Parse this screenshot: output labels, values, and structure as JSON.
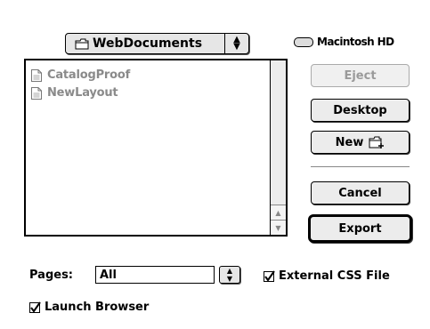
{
  "folder_popup": {
    "label": "WebDocuments",
    "icon": "folder-icon"
  },
  "volume": {
    "label": "Macintosh HD",
    "icon": "hard-drive-icon"
  },
  "file_list": {
    "items": [
      {
        "name": "CatalogProof",
        "icon": "document-icon"
      },
      {
        "name": "NewLayout",
        "icon": "document-icon"
      }
    ]
  },
  "buttons": {
    "eject": "Eject",
    "desktop": "Desktop",
    "new": "New",
    "cancel": "Cancel",
    "export": "Export"
  },
  "pages": {
    "label": "Pages:",
    "value": "All"
  },
  "options": {
    "external_css": {
      "label": "External CSS File",
      "checked": true
    },
    "launch_browser": {
      "label": "Launch Browser",
      "checked": true
    }
  }
}
